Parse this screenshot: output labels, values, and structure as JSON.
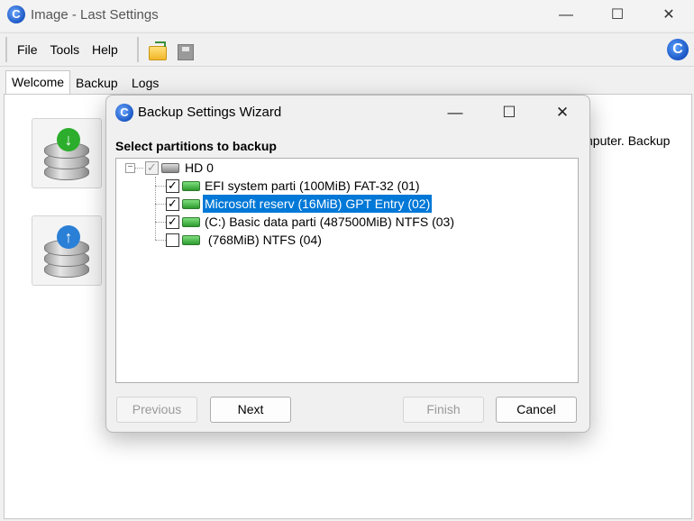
{
  "window": {
    "title": "Image - Last Settings",
    "app_icon_letter": "C",
    "minimize": "—",
    "maximize": "☐",
    "close": "✕"
  },
  "menu": {
    "items": [
      "File",
      "Tools",
      "Help"
    ]
  },
  "toolbar": {
    "icons": [
      "open-folder-icon",
      "save-disk-icon"
    ],
    "brand_letter": "C"
  },
  "tabs": [
    "Welcome",
    "Backup",
    "Logs"
  ],
  "welcome": {
    "partial_text": "nputer. Backup"
  },
  "dialog": {
    "title": "Backup Settings Wizard",
    "icon_letter": "C",
    "minimize": "—",
    "maximize": "☐",
    "close": "✕",
    "section_label": "Select partitions to backup",
    "tree": {
      "disk": {
        "label": "HD 0",
        "checked": true,
        "expander": "−"
      },
      "partitions": [
        {
          "label": "EFI system parti (100MiB) FAT-32 (01)",
          "checked": true,
          "selected": false
        },
        {
          "label": "Microsoft reserv (16MiB) GPT Entry (02)",
          "checked": true,
          "selected": true
        },
        {
          "label": "(C:) Basic data parti (487500MiB) NTFS (03)",
          "checked": true,
          "selected": false
        },
        {
          "label": " (768MiB) NTFS (04)",
          "checked": false,
          "selected": false
        }
      ]
    },
    "buttons": {
      "previous": "Previous",
      "next": "Next",
      "finish": "Finish",
      "cancel": "Cancel"
    }
  }
}
